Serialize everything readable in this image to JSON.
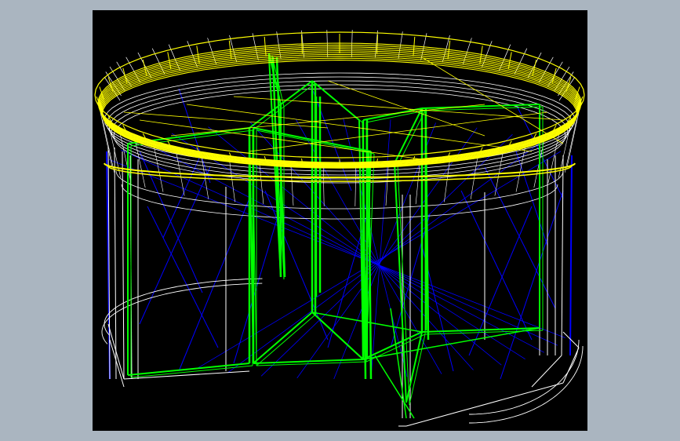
{
  "viewport": {
    "background": "#000000",
    "window_background": "#aab5c0"
  },
  "wireframe": {
    "model": "round-revolving-door-housing",
    "edge_colors": {
      "canopy": "#ffff00",
      "frame": "#ffffff",
      "door-wings": "#00ff00",
      "glass-diagonals": "#0000ff"
    }
  }
}
